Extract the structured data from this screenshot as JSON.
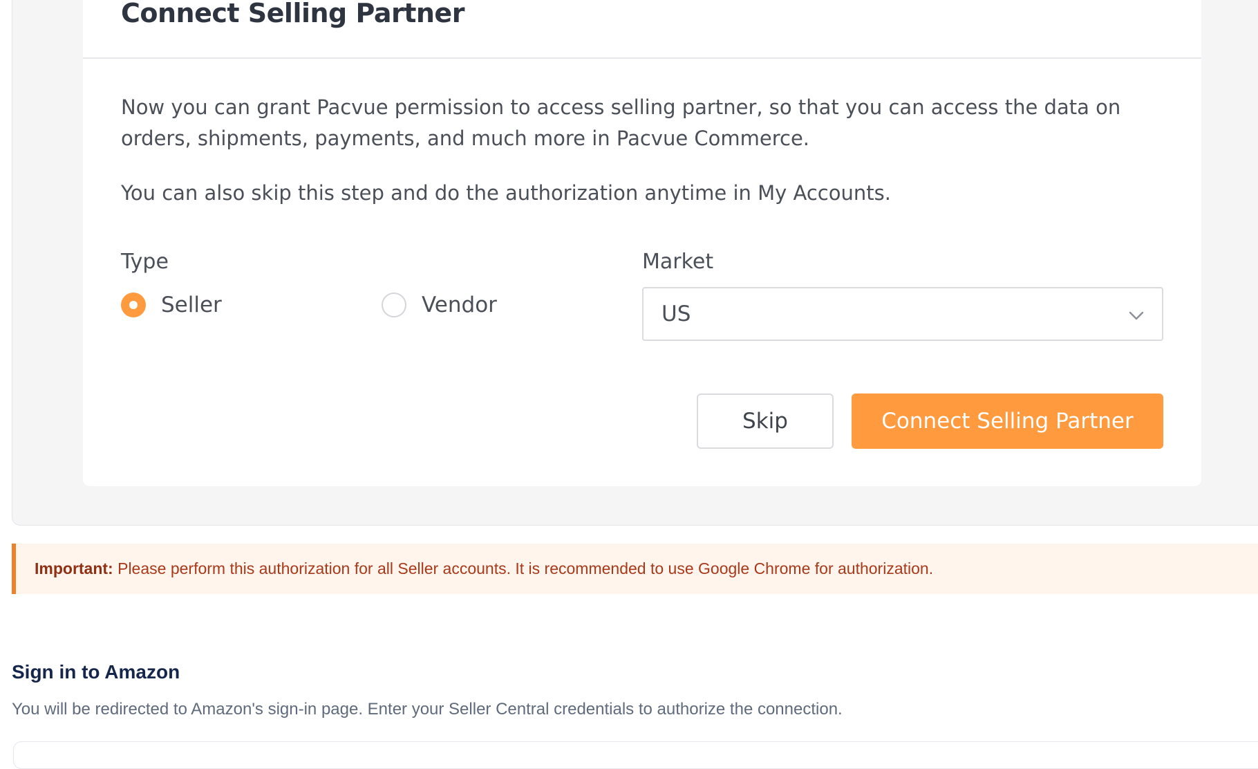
{
  "dialog": {
    "title": "Connect Selling Partner",
    "description_1": "Now you can grant Pacvue permission to access selling partner, so that you can access the data on orders, shipments, payments, and much more in Pacvue Commerce.",
    "description_2": "You can also skip this step and do the authorization anytime in My Accounts.",
    "type_label": "Type",
    "type_options": [
      {
        "label": "Seller",
        "selected": true
      },
      {
        "label": "Vendor",
        "selected": false
      }
    ],
    "market_label": "Market",
    "market_value": "US",
    "skip_label": "Skip",
    "connect_label": "Connect Selling Partner"
  },
  "notice": {
    "strong": "Important:",
    "text": " Please perform this authorization for all Seller accounts. It is recommended to use Google Chrome for authorization."
  },
  "signin": {
    "title": "Sign in to Amazon",
    "description": "You will be redirected to Amazon's sign-in page. Enter your Seller Central credentials to authorize the connection."
  },
  "colors": {
    "accent": "#ff9a3e",
    "notice_border": "#f0812a",
    "notice_background": "#fff5ec",
    "notice_text": "#a8391a",
    "signin_title": "#16264a"
  },
  "icons": {
    "market_dropdown": "chevron-down-icon"
  }
}
